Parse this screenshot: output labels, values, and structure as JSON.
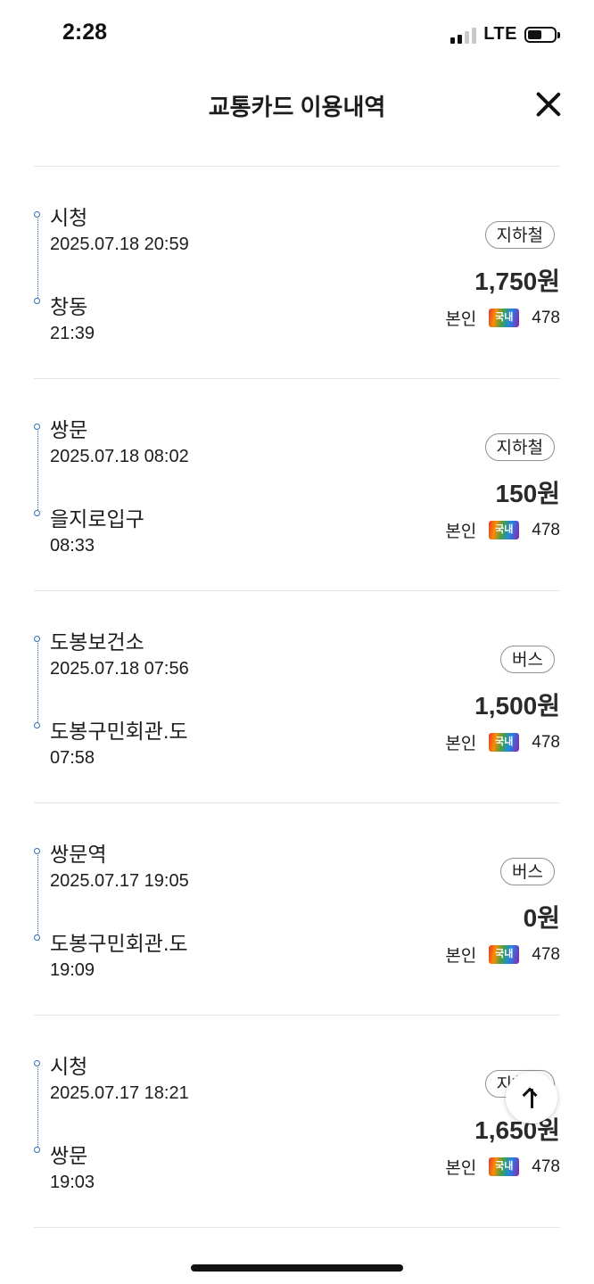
{
  "status_bar": {
    "time": "2:28",
    "network": "LTE",
    "battery_level": 0.55
  },
  "header": {
    "title": "교통카드 이용내역",
    "close_icon": "close-icon"
  },
  "trips": [
    {
      "from_stop": "시청",
      "from_datetime": "2025.07.18 20:59",
      "to_stop": "창동",
      "to_time": "21:39",
      "mode": "지하철",
      "fare": "1,750원",
      "holder": "본인",
      "card_label": "국내",
      "card_number": "478"
    },
    {
      "from_stop": "쌍문",
      "from_datetime": "2025.07.18 08:02",
      "to_stop": "을지로입구",
      "to_time": "08:33",
      "mode": "지하철",
      "fare": "150원",
      "holder": "본인",
      "card_label": "국내",
      "card_number": "478"
    },
    {
      "from_stop": "도봉보건소",
      "from_datetime": "2025.07.18 07:56",
      "to_stop": "도봉구민회관.도",
      "to_time": "07:58",
      "mode": "버스",
      "fare": "1,500원",
      "holder": "본인",
      "card_label": "국내",
      "card_number": "478"
    },
    {
      "from_stop": "쌍문역",
      "from_datetime": "2025.07.17 19:05",
      "to_stop": "도봉구민회관.도",
      "to_time": "19:09",
      "mode": "버스",
      "fare": "0원",
      "holder": "본인",
      "card_label": "국내",
      "card_number": "478"
    },
    {
      "from_stop": "시청",
      "from_datetime": "2025.07.17 18:21",
      "to_stop": "쌍문",
      "to_time": "19:03",
      "mode": "지하철",
      "fare": "1,650원",
      "holder": "본인",
      "card_label": "국내",
      "card_number": "478"
    }
  ],
  "scroll_top_icon": "arrow-up-icon",
  "colors": {
    "timeline": "#2c6fb7",
    "divider": "#e6e6e6",
    "badge_border": "#8f8f8f"
  }
}
